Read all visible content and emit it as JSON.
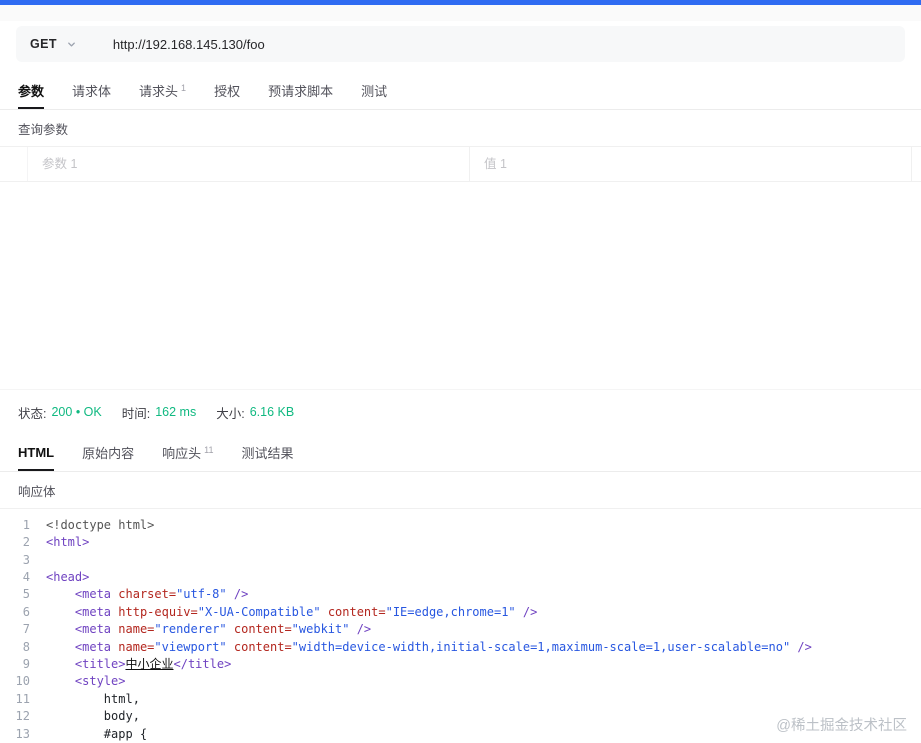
{
  "colors": {
    "accent": "#2f6bf2",
    "status-green": "#10b981",
    "code-tag": "#6f42c1",
    "code-attr": "#b3261e",
    "code-string": "#2857e0",
    "code-meta": "#555555"
  },
  "request": {
    "method": "GET",
    "url": "http://192.168.145.130/foo"
  },
  "request_tabs": [
    {
      "label": "参数",
      "active": true
    },
    {
      "label": "请求体"
    },
    {
      "label": "请求头",
      "badge": "1"
    },
    {
      "label": "授权"
    },
    {
      "label": "预请求脚本"
    },
    {
      "label": "测试"
    }
  ],
  "query": {
    "section_label": "查询参数",
    "row": {
      "key_placeholder": "参数 1",
      "value_placeholder": "值 1"
    }
  },
  "response": {
    "status_label": "状态:",
    "status_value": "200 • OK",
    "time_label": "时间:",
    "time_value": "162 ms",
    "size_label": "大小:",
    "size_value": "6.16 KB",
    "tabs": [
      {
        "label": "HTML",
        "active": true
      },
      {
        "label": "原始内容"
      },
      {
        "label": "响应头",
        "badge": "11"
      },
      {
        "label": "测试结果"
      }
    ],
    "body_label": "响应体"
  },
  "code": {
    "lines": [
      {
        "no": "1",
        "tokens": [
          [
            "meta",
            "<!doctype html>"
          ]
        ]
      },
      {
        "no": "2",
        "tokens": [
          [
            "tag",
            "<html>"
          ]
        ]
      },
      {
        "no": "3",
        "tokens": []
      },
      {
        "no": "4",
        "tokens": [
          [
            "tag",
            "<head>"
          ]
        ]
      },
      {
        "no": "5",
        "tokens": [
          [
            "plain",
            "    "
          ],
          [
            "tag",
            "<meta"
          ],
          [
            "plain",
            " "
          ],
          [
            "attr",
            "charset="
          ],
          [
            "string",
            "\"utf-8\""
          ],
          [
            "plain",
            " "
          ],
          [
            "tag",
            "/>"
          ]
        ]
      },
      {
        "no": "6",
        "tokens": [
          [
            "plain",
            "    "
          ],
          [
            "tag",
            "<meta"
          ],
          [
            "plain",
            " "
          ],
          [
            "attr",
            "http-equiv="
          ],
          [
            "string",
            "\"X-UA-Compatible\""
          ],
          [
            "plain",
            " "
          ],
          [
            "attr",
            "content="
          ],
          [
            "string",
            "\"IE=edge,chrome=1\""
          ],
          [
            "plain",
            " "
          ],
          [
            "tag",
            "/>"
          ]
        ]
      },
      {
        "no": "7",
        "tokens": [
          [
            "plain",
            "    "
          ],
          [
            "tag",
            "<meta"
          ],
          [
            "plain",
            " "
          ],
          [
            "attr",
            "name="
          ],
          [
            "string",
            "\"renderer\""
          ],
          [
            "plain",
            " "
          ],
          [
            "attr",
            "content="
          ],
          [
            "string",
            "\"webkit\""
          ],
          [
            "plain",
            " "
          ],
          [
            "tag",
            "/>"
          ]
        ]
      },
      {
        "no": "8",
        "tokens": [
          [
            "plain",
            "    "
          ],
          [
            "tag",
            "<meta"
          ],
          [
            "plain",
            " "
          ],
          [
            "attr",
            "name="
          ],
          [
            "string",
            "\"viewport\""
          ],
          [
            "plain",
            " "
          ],
          [
            "attr",
            "content="
          ],
          [
            "string",
            "\"width=device-width,initial-scale=1,maximum-scale=1,user-scalable=no\""
          ],
          [
            "plain",
            " "
          ],
          [
            "tag",
            "/>"
          ]
        ]
      },
      {
        "no": "9",
        "tokens": [
          [
            "plain",
            "    "
          ],
          [
            "tag",
            "<title>"
          ],
          [
            "title",
            "中小企业"
          ],
          [
            "tag",
            "</title>"
          ]
        ]
      },
      {
        "no": "10",
        "tokens": [
          [
            "plain",
            "    "
          ],
          [
            "tag",
            "<style>"
          ]
        ]
      },
      {
        "no": "11",
        "tokens": [
          [
            "plain",
            "        html,"
          ]
        ]
      },
      {
        "no": "12",
        "tokens": [
          [
            "plain",
            "        body,"
          ]
        ]
      },
      {
        "no": "13",
        "tokens": [
          [
            "plain",
            "        #app {"
          ]
        ]
      }
    ]
  },
  "watermark": "@稀土掘金技术社区"
}
